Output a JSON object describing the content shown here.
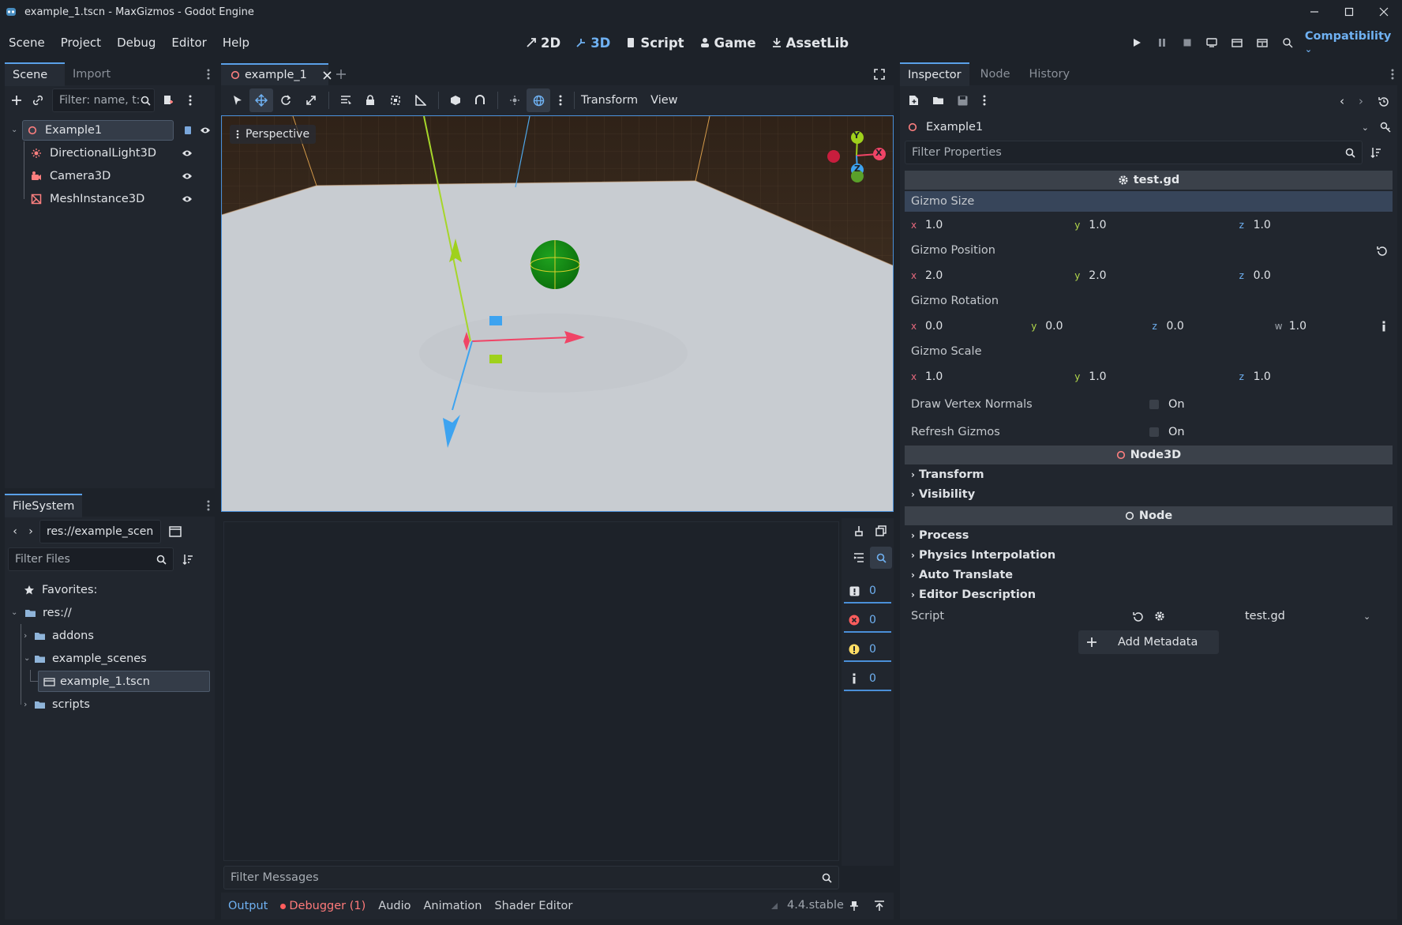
{
  "window": {
    "title": "example_1.tscn - MaxGizmos - Godot Engine"
  },
  "menu": [
    "Scene",
    "Project",
    "Debug",
    "Editor",
    "Help"
  ],
  "workspaces": [
    {
      "label": "2D",
      "icon": "2d-icon"
    },
    {
      "label": "3D",
      "icon": "3d-icon",
      "active": true
    },
    {
      "label": "Script",
      "icon": "script-icon"
    },
    {
      "label": "Game",
      "icon": "game-icon"
    },
    {
      "label": "AssetLib",
      "icon": "assetlib-icon"
    }
  ],
  "renderer": "Compatibility",
  "scene_dock": {
    "tabs": [
      "Scene",
      "Import"
    ],
    "filter_placeholder": "Filter: name, t:t",
    "nodes": [
      {
        "name": "Example1",
        "icon": "node3d-icon",
        "color": "#fc7f7f",
        "selected": true
      },
      {
        "name": "DirectionalLight3D",
        "icon": "light-icon",
        "color": "#fc7f7f"
      },
      {
        "name": "Camera3D",
        "icon": "camera-icon",
        "color": "#fc7f7f"
      },
      {
        "name": "MeshInstance3D",
        "icon": "mesh-icon",
        "color": "#fc7f7f"
      }
    ]
  },
  "filesystem": {
    "tab": "FileSystem",
    "path": "res://example_scenes/exa",
    "filter_placeholder": "Filter Files",
    "favorites": "Favorites:",
    "items": [
      {
        "label": "res://",
        "depth": 0,
        "type": "folder",
        "expanded": true
      },
      {
        "label": "addons",
        "depth": 1,
        "type": "folder"
      },
      {
        "label": "example_scenes",
        "depth": 1,
        "type": "folder",
        "expanded": true
      },
      {
        "label": "example_1.tscn",
        "depth": 2,
        "type": "scene",
        "selected": true
      },
      {
        "label": "scripts",
        "depth": 1,
        "type": "folder"
      }
    ]
  },
  "viewport": {
    "tab": "example_1",
    "toolbar_menus": [
      "Transform",
      "View"
    ],
    "perspective": "Perspective",
    "gizmo_axes": {
      "x": "X",
      "y": "Y",
      "z": "Z"
    }
  },
  "output": {
    "filter_placeholder": "Filter Messages",
    "counters": [
      "0",
      "0",
      "0",
      "0"
    ],
    "tabs": [
      "Output",
      "Debugger (1)",
      "Audio",
      "Animation",
      "Shader Editor"
    ],
    "version": "4.4.stable"
  },
  "inspector": {
    "tabs": [
      "Inspector",
      "Node",
      "History"
    ],
    "object": "Example1",
    "filter_placeholder": "Filter Properties",
    "script_header": "test.gd",
    "gizmo_size": {
      "label": "Gizmo Size",
      "x": "1.0",
      "y": "1.0",
      "z": "1.0"
    },
    "gizmo_position": {
      "label": "Gizmo Position",
      "x": "2.0",
      "y": "2.0",
      "z": "0.0"
    },
    "gizmo_rotation": {
      "label": "Gizmo Rotation",
      "x": "0.0",
      "y": "0.0",
      "z": "0.0",
      "w": "1.0"
    },
    "gizmo_scale": {
      "label": "Gizmo Scale",
      "x": "1.0",
      "y": "1.0",
      "z": "1.0"
    },
    "draw_vertex_normals": {
      "label": "Draw Vertex Normals",
      "value": "On"
    },
    "refresh_gizmos": {
      "label": "Refresh Gizmos",
      "value": "On"
    },
    "node3d_header": "Node3D",
    "node3d_groups": [
      "Transform",
      "Visibility"
    ],
    "node_header": "Node",
    "node_groups": [
      "Process",
      "Physics Interpolation",
      "Auto Translate",
      "Editor Description"
    ],
    "script_label": "Script",
    "script_value": "test.gd",
    "add_metadata": "Add Metadata"
  },
  "axis_letters": {
    "x": "x",
    "y": "y",
    "z": "z",
    "w": "w"
  }
}
